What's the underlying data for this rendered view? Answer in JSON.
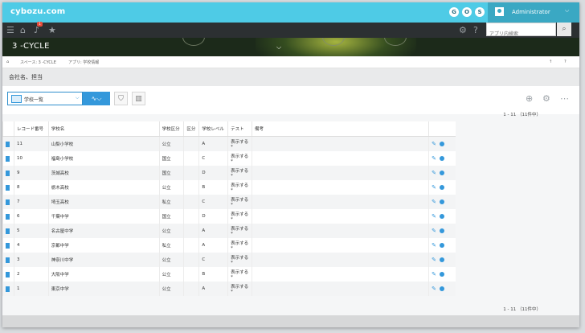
{
  "header": {
    "logo": "cybozu.com",
    "icons": [
      "G",
      "O",
      "S"
    ],
    "user": "Administrator"
  },
  "nav": {
    "search_placeholder": "アプリ内検索",
    "notification_count": "1"
  },
  "app": {
    "title": "3 -CYCLE"
  },
  "breadcrumb": {
    "space": "スペース: 3 -CYCLE",
    "app": "アプリ: 学校情報"
  },
  "filter": {
    "text": "会社名、担当"
  },
  "view": {
    "name": "学校一覧"
  },
  "pager": {
    "text": "1 - 11 （11件中）"
  },
  "table": {
    "columns": [
      "",
      "レコード番号",
      "学校名",
      "学校区分",
      "区分",
      "学校レベル",
      "テスト",
      "備考",
      ""
    ],
    "rows": [
      {
        "id": "11",
        "name": "山梨小学校",
        "type": "公立",
        "level": "A",
        "test": "表示する*"
      },
      {
        "id": "10",
        "name": "福島小学校",
        "type": "国立",
        "level": "C",
        "test": "表示する*"
      },
      {
        "id": "9",
        "name": "茨城高校",
        "type": "国立",
        "level": "D",
        "test": "表示する*"
      },
      {
        "id": "8",
        "name": "栃木高校",
        "type": "公立",
        "level": "B",
        "test": "表示する*"
      },
      {
        "id": "7",
        "name": "埼玉高校",
        "type": "私立",
        "level": "C",
        "test": "表示する*"
      },
      {
        "id": "6",
        "name": "千葉中学",
        "type": "国立",
        "level": "D",
        "test": "表示する*"
      },
      {
        "id": "5",
        "name": "名古屋中学",
        "type": "公立",
        "level": "A",
        "test": "表示する*"
      },
      {
        "id": "4",
        "name": "京都中学",
        "type": "私立",
        "level": "A",
        "test": "表示する*"
      },
      {
        "id": "3",
        "name": "神奈川中学",
        "type": "公立",
        "level": "C",
        "test": "表示する*"
      },
      {
        "id": "2",
        "name": "大阪中学",
        "type": "公立",
        "level": "B",
        "test": "表示する*"
      },
      {
        "id": "1",
        "name": "東京中学",
        "type": "公立",
        "level": "A",
        "test": "表示する*"
      }
    ]
  },
  "colors": {
    "topbar": "#4ecbe6",
    "accent": "#3498db",
    "navbar": "#2c3032"
  }
}
